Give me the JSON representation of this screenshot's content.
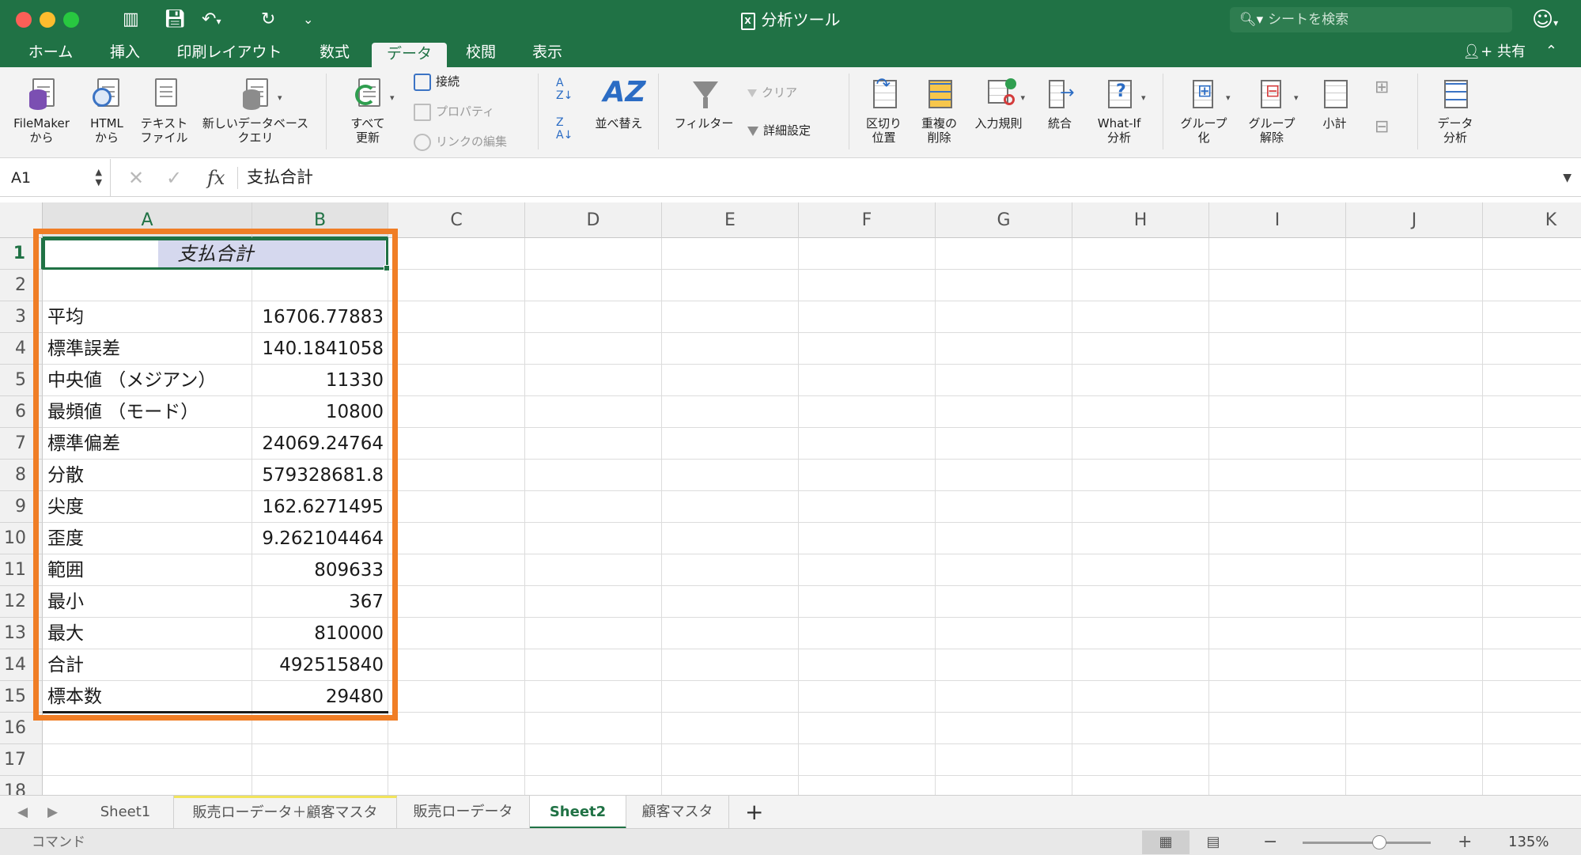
{
  "window": {
    "title": "分析ツール",
    "search_placeholder": "シートを検索",
    "share_label": "共有"
  },
  "tabs": [
    "ホーム",
    "挿入",
    "印刷レイアウト",
    "数式",
    "データ",
    "校閲",
    "表示"
  ],
  "active_tab": "データ",
  "ribbon": {
    "filemaker": "FileMaker\nから",
    "html": "HTML\nから",
    "text_file": "テキスト\nファイル",
    "new_db_query": "新しいデータベース\nクエリ",
    "refresh_all": "すべて\n更新",
    "connections": "接続",
    "properties": "プロパティ",
    "edit_links": "リンクの編集",
    "sort": "並べ替え",
    "filter": "フィルター",
    "clear": "クリア",
    "advanced": "詳細設定",
    "text_to_columns": "区切り\n位置",
    "remove_duplicates": "重複の\n削除",
    "data_validation": "入力規則",
    "consolidate": "統合",
    "what_if": "What-If\n分析",
    "group": "グループ\n化",
    "ungroup": "グループ\n解除",
    "subtotal": "小計",
    "data_analysis": "データ\n分析"
  },
  "formula_bar": {
    "name_box": "A1",
    "formula": "支払合計"
  },
  "columns": [
    "A",
    "B",
    "C",
    "D",
    "E",
    "F",
    "G",
    "H",
    "I",
    "J",
    "K"
  ],
  "rows": [
    "1",
    "2",
    "3",
    "4",
    "5",
    "6",
    "7",
    "8",
    "9",
    "10",
    "11",
    "12",
    "13",
    "14",
    "15",
    "16",
    "17",
    "18"
  ],
  "sheet": {
    "header": "支払合計",
    "stats": [
      {
        "label": "平均",
        "value": "16706.77883"
      },
      {
        "label": "標準誤差",
        "value": "140.1841058"
      },
      {
        "label": "中央値 （メジアン）",
        "value": "11330"
      },
      {
        "label": "最頻値 （モード）",
        "value": "10800"
      },
      {
        "label": "標準偏差",
        "value": "24069.24764"
      },
      {
        "label": "分散",
        "value": "579328681.8"
      },
      {
        "label": "尖度",
        "value": "162.6271495"
      },
      {
        "label": "歪度",
        "value": "9.262104464"
      },
      {
        "label": "範囲",
        "value": "809633"
      },
      {
        "label": "最小",
        "value": "367"
      },
      {
        "label": "最大",
        "value": "810000"
      },
      {
        "label": "合計",
        "value": "492515840"
      },
      {
        "label": "標本数",
        "value": "29480"
      }
    ]
  },
  "sheet_tabs": [
    "Sheet1",
    "販売ローデータ＋顧客マスタ",
    "販売ローデータ",
    "Sheet2",
    "顧客マスタ"
  ],
  "active_sheet": "Sheet2",
  "status": {
    "mode": "コマンド",
    "zoom": "135%"
  },
  "colors": {
    "brand": "#207245",
    "highlight": "#f07e26",
    "selection": "#d5d8ee"
  }
}
